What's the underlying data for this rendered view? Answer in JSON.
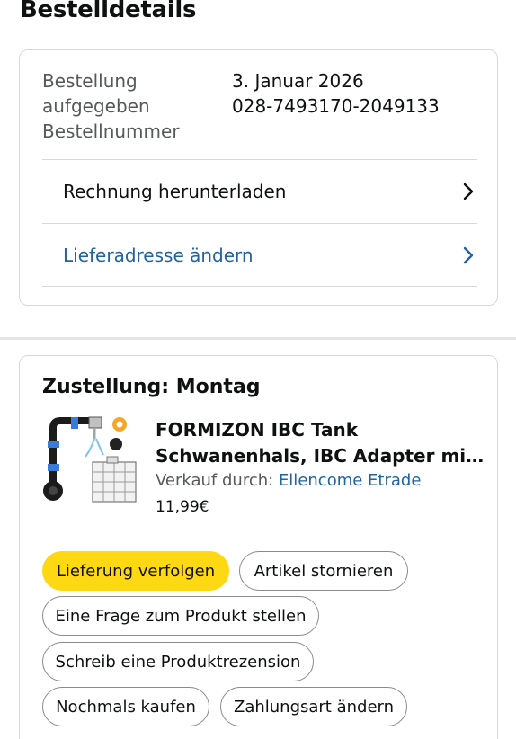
{
  "page": {
    "title": "Bestelldetails"
  },
  "order": {
    "labels": {
      "placed": "Bestellung aufgegeben",
      "number": "Bestellnummer"
    },
    "values": {
      "placed": "3. Januar 2026",
      "number": "028-7493170-2049133"
    },
    "rows": [
      {
        "label": "Rechnung herunterladen",
        "icon": "chevron-right-icon",
        "color": "#0f1111"
      },
      {
        "label": "Lieferadresse ändern",
        "icon": "chevron-right-icon",
        "color": "#2162a1"
      }
    ]
  },
  "delivery": {
    "heading": "Zustellung: Montag",
    "product": {
      "image_icon": "ibc-tank-adapter-product-image",
      "title_line1": "FORMIZON IBC Tank",
      "title_line2": "Schwanenhals, IBC Adapter mit...",
      "seller_prefix": "Verkauf durch:",
      "seller_name": "Ellencome Etrade",
      "price": "11,99€"
    },
    "actions": {
      "track": "Lieferung verfolgen",
      "cancel": "Artikel stornieren",
      "ask": "Eine Frage zum Produkt stellen",
      "review": "Schreib eine Produktrezension",
      "buy_again": "Nochmals kaufen",
      "change_payment": "Zahlungsart ändern"
    }
  },
  "colors": {
    "primary_button": "#ffd814",
    "link": "#2162a1",
    "border": "#d5d9d9",
    "text": "#0f1111",
    "secondary_text": "#565959"
  }
}
